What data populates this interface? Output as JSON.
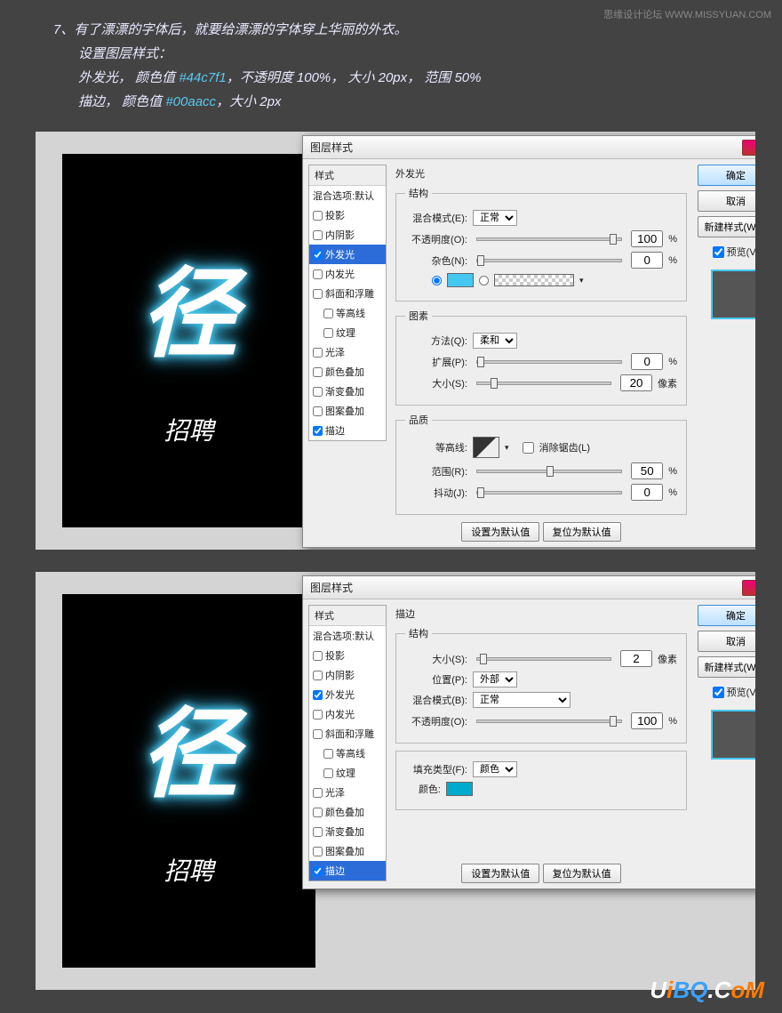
{
  "watermark": "思缘设计论坛 WWW.MISSYUAN.COM",
  "intro": {
    "line1": "7、有了漂漂的字体后，就要给漂漂的字体穿上华丽的外衣。",
    "line2": "设置图层样式：",
    "line3a": "外发光，  颜色值 ",
    "hex1": "#44c7f1",
    "line3b": "，不透明度 100%，  大小 20px，  范围 50%",
    "line4a": "描边，  颜色值 ",
    "hex2": "#00aacc",
    "line4b": "，大小 2px"
  },
  "canvas": {
    "big": "径",
    "small": "招聘"
  },
  "dialog": {
    "title": "图层样式",
    "close": "×",
    "styles_header": "样式",
    "blend_default": "混合选项:默认",
    "items": [
      {
        "label": "投影",
        "checked": false
      },
      {
        "label": "内阴影",
        "checked": false
      },
      {
        "label": "外发光",
        "checked": true
      },
      {
        "label": "内发光",
        "checked": false
      },
      {
        "label": "斜面和浮雕",
        "checked": false
      },
      {
        "label": "等高线",
        "checked": false,
        "indent": true
      },
      {
        "label": "纹理",
        "checked": false,
        "indent": true
      },
      {
        "label": "光泽",
        "checked": false
      },
      {
        "label": "颜色叠加",
        "checked": false
      },
      {
        "label": "渐变叠加",
        "checked": false
      },
      {
        "label": "图案叠加",
        "checked": false
      },
      {
        "label": "描边",
        "checked": true
      }
    ],
    "outer_glow": {
      "title": "外发光",
      "structure": "结构",
      "blend_mode_l": "混合模式(E):",
      "blend_mode_v": "正常",
      "opacity_l": "不透明度(O):",
      "opacity_v": "100",
      "pct": "%",
      "noise_l": "杂色(N):",
      "noise_v": "0",
      "elements": "图素",
      "method_l": "方法(Q):",
      "method_v": "柔和",
      "spread_l": "扩展(P):",
      "spread_v": "0",
      "size_l": "大小(S):",
      "size_v": "20",
      "px": "像素",
      "quality": "品质",
      "contour_l": "等高线:",
      "aa_l": "消除锯齿(L)",
      "range_l": "范围(R):",
      "range_v": "50",
      "jitter_l": "抖动(J):",
      "jitter_v": "0",
      "set_default": "设置为默认值",
      "reset_default": "复位为默认值"
    },
    "stroke": {
      "title": "描边",
      "structure": "结构",
      "size_l": "大小(S):",
      "size_v": "2",
      "px": "像素",
      "pos_l": "位置(P):",
      "pos_v": "外部",
      "blend_l": "混合模式(B):",
      "blend_v": "正常",
      "opacity_l": "不透明度(O):",
      "opacity_v": "100",
      "pct": "%",
      "fill_type_l": "填充类型(F):",
      "fill_type_v": "颜色",
      "color_l": "颜色:",
      "set_default": "设置为默认值",
      "reset_default": "复位为默认值"
    },
    "right": {
      "ok": "确定",
      "cancel": "取消",
      "new_style": "新建样式(W)...",
      "preview": "预览(V)"
    }
  },
  "logo": {
    "u": "U",
    "i": "i",
    "b": "B",
    "q": "Q",
    "dot": ".",
    "c": "C",
    "o": "o",
    "m": "M"
  }
}
